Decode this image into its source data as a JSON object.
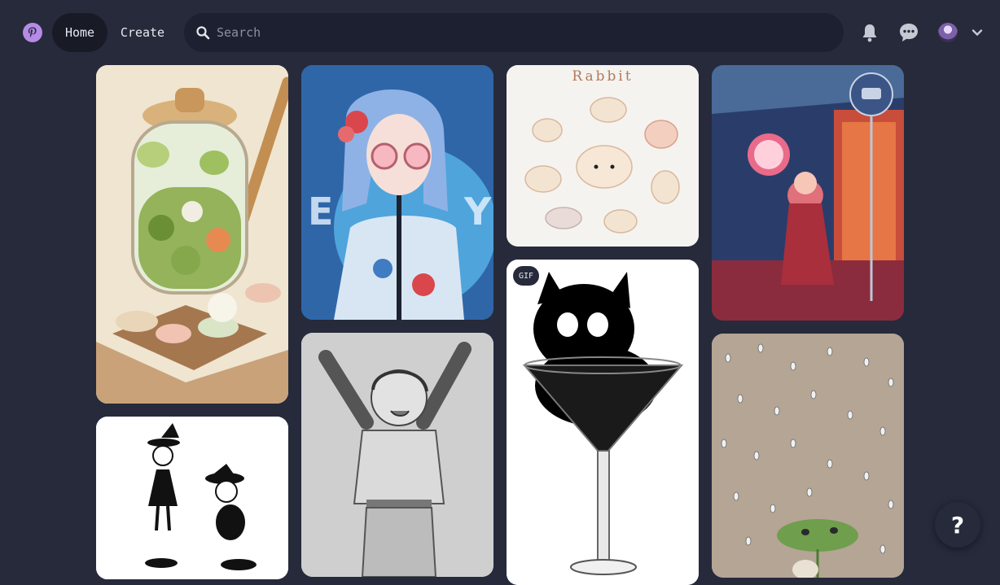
{
  "nav": {
    "home_label": "Home",
    "create_label": "Create"
  },
  "search": {
    "placeholder": "Search"
  },
  "icons": {
    "logo": "pinterest-logo",
    "search": "search-icon",
    "notifications": "bell-icon",
    "messages": "chat-bubble-icon",
    "account_menu": "chevron-down-icon",
    "help": "question-mark-icon"
  },
  "pins": [
    {
      "id": "jar",
      "image": "glass jar with greens and citrus, chopsticks"
    },
    {
      "id": "blue-girl",
      "image": "blue-haired girl with round pink sunglasses"
    },
    {
      "id": "rabbit",
      "title": "Rabbit",
      "image": "chubby bunny sketches"
    },
    {
      "id": "neon",
      "image": "girl in red coat under neon shop sign"
    },
    {
      "id": "witch",
      "image": "two small witches in black and white"
    },
    {
      "id": "sketch",
      "image": "pencil sketch boy with arms raised"
    },
    {
      "id": "cat-glass",
      "badge": "GIF",
      "image": "black cat in martini glass"
    },
    {
      "id": "rain",
      "image": "raindrops with creature under leaf"
    }
  ],
  "help": {
    "label": "?"
  },
  "colors": {
    "background": "#262a3b",
    "active_nav": "#181b26",
    "search_bg": "#1c2030",
    "logo": "#b58be6"
  }
}
